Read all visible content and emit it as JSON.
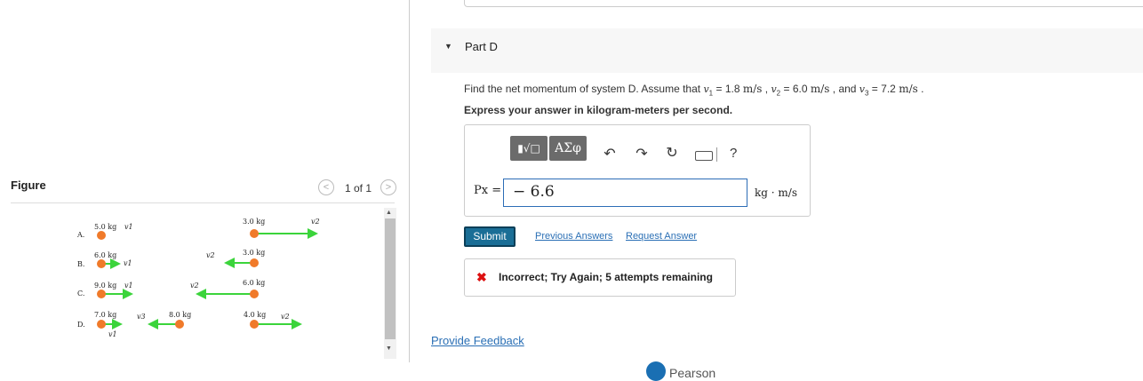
{
  "figure": {
    "title": "Figure",
    "pagination": {
      "prev_icon": "<",
      "next_icon": ">",
      "label": "1 of 1"
    },
    "systems": [
      {
        "id": "A.",
        "objects": [
          {
            "mass": "5.0 kg",
            "velocity": "v1",
            "direction": "right"
          },
          {
            "mass": "3.0 kg",
            "velocity": "v2",
            "direction": "right"
          }
        ]
      },
      {
        "id": "B.",
        "objects": [
          {
            "mass": "6.0 kg",
            "velocity": "v1",
            "direction": "right"
          },
          {
            "mass": "3.0 kg",
            "velocity": "v2",
            "direction": "left"
          }
        ]
      },
      {
        "id": "C.",
        "objects": [
          {
            "mass": "9.0 kg",
            "velocity": "v1",
            "direction": "right"
          },
          {
            "mass": "6.0 kg",
            "velocity": "v2",
            "direction": "left"
          }
        ]
      },
      {
        "id": "D.",
        "objects": [
          {
            "mass": "7.0 kg",
            "velocity": "v1",
            "direction": "right"
          },
          {
            "mass": "8.0 kg",
            "velocity": "v3",
            "direction": "left"
          },
          {
            "mass": "4.0 kg",
            "velocity": "v2",
            "direction": "right"
          }
        ]
      }
    ],
    "arrow_color": "#3bd43b",
    "ball_color": "#f07a2a"
  },
  "part": {
    "caret_icon": "▼",
    "label": "Part D"
  },
  "question": {
    "prefix": "Find the net momentum of system D. Assume that ",
    "v1": "1.8",
    "v2": "6.0",
    "v3": "7.2",
    "unit": "m/s",
    "instruction": "Express your answer in kilogram-meters per second."
  },
  "toolbar": {
    "template_label": "▮√□",
    "greek_label": "ΑΣφ",
    "undo_icon": "undo-icon",
    "redo_icon": "redo-icon",
    "reset_icon": "reset-icon",
    "keyboard_icon": "keyboard-icon",
    "help_label": "?"
  },
  "answer": {
    "label": "Px =",
    "value": "− 6.6",
    "unit": "kg · m/s"
  },
  "actions": {
    "submit_label": "Submit",
    "previous_answers": "Previous Answers",
    "request_answer": "Request Answer"
  },
  "feedback": {
    "icon": "✖",
    "text": "Incorrect; Try Again; 5 attempts remaining"
  },
  "footer": {
    "provide_feedback": "Provide Feedback",
    "brand": "Pearson"
  }
}
